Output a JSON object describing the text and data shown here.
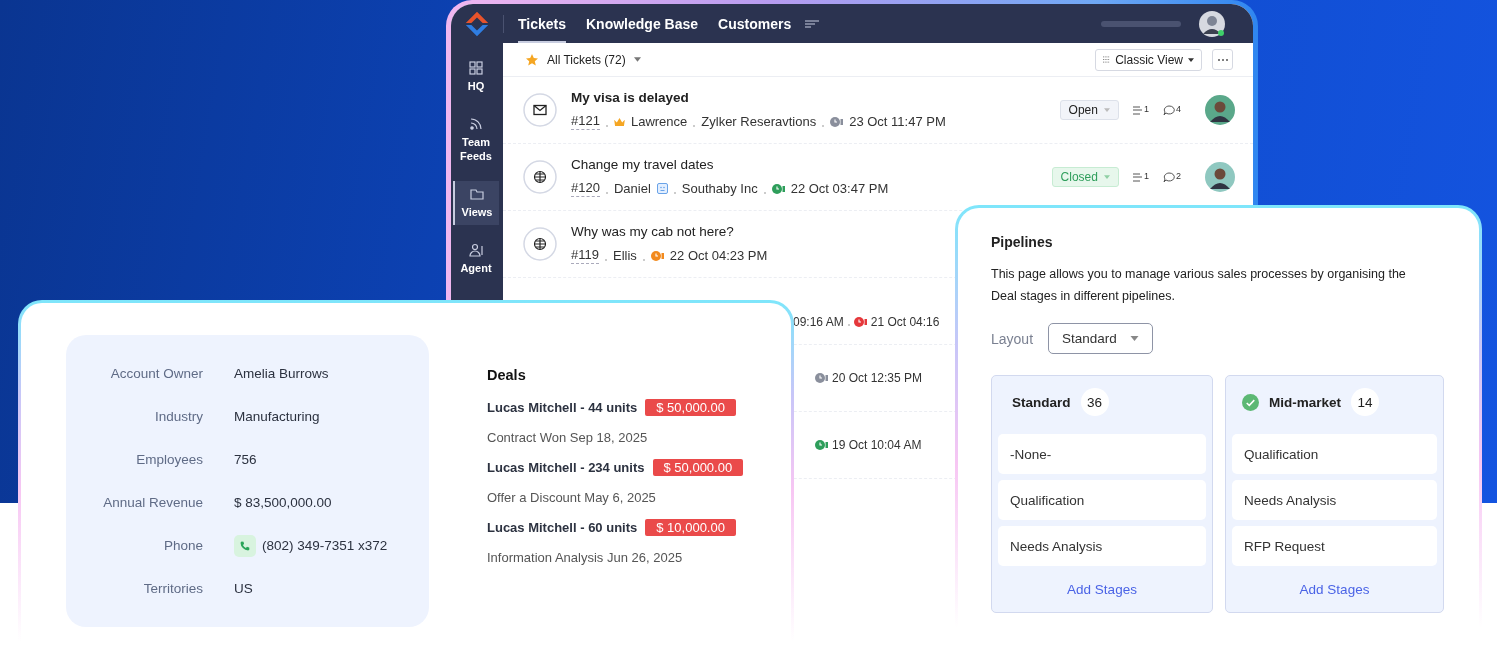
{
  "helpdesk": {
    "nav": [
      {
        "label": "Tickets",
        "selected": true
      },
      {
        "label": "Knowledge Base",
        "selected": false
      },
      {
        "label": "Customers",
        "selected": false
      }
    ],
    "sidebar": [
      {
        "label": "HQ",
        "selected": false
      },
      {
        "label": "Team Feeds",
        "selected": false
      },
      {
        "label": "Views",
        "selected": true
      },
      {
        "label": "Agent",
        "selected": false
      }
    ],
    "view_title": "All Tickets (72)",
    "view_mode": "Classic View",
    "tickets": [
      {
        "kind": "full",
        "title": "My visa is delayed",
        "bold": true,
        "number": "#121",
        "contact": "Lawrence",
        "account": "Zylker Reseravtions",
        "time": "23 Oct 11:47 PM",
        "color": "#8a8f9c",
        "status": {
          "label": "Open",
          "kind": "open"
        },
        "threads": "1",
        "comments": "4"
      },
      {
        "kind": "full",
        "title": "Change my travel dates",
        "bold": false,
        "number": "#120",
        "contact": "Daniel",
        "account": "Southaby Inc",
        "time": "22 Oct 03:47 PM",
        "color": "#2e9e5b",
        "status": {
          "label": "Closed",
          "kind": "closed"
        },
        "threads": "1",
        "comments": "2"
      },
      {
        "kind": "full",
        "title": "Why was my cab not here?",
        "bold": false,
        "number": "#119",
        "contact": "Ellis",
        "time": "22 Oct 04:23 PM",
        "color": "#f28a1e"
      },
      {
        "kind": "partial",
        "fragments": [
          {
            "text": "09:16 AM"
          },
          {
            "text": "21 Oct 04:16",
            "color": "#e5383b"
          }
        ]
      },
      {
        "kind": "partial",
        "fragments": [
          {
            "text": "20 Oct 12:35 PM",
            "color": "#8a8f9c"
          }
        ]
      },
      {
        "kind": "partial",
        "fragments": [
          {
            "text": "19 Oct 10:04 AM",
            "color": "#2e9e5b"
          }
        ]
      }
    ]
  },
  "account": {
    "fields": [
      {
        "label": "Account Owner",
        "value": "Amelia Burrows"
      },
      {
        "label": "Industry",
        "value": "Manufacturing"
      },
      {
        "label": "Employees",
        "value": "756"
      },
      {
        "label": "Annual Revenue",
        "value": "$ 83,500,000.00"
      },
      {
        "label": "Phone",
        "value": "(802) 349-7351 x372",
        "kind": "phone"
      },
      {
        "label": "Territories",
        "value": "US"
      }
    ],
    "deals_title": "Deals",
    "deals": [
      {
        "name": "Lucas Mitchell - 44 units",
        "amount": "$ 50,000.00",
        "stage": "Contract Won Sep 18, 2025"
      },
      {
        "name": "Lucas Mitchell - 234 units",
        "amount": "$ 50,000.00",
        "stage": "Offer a Discount May 6, 2025"
      },
      {
        "name": "Lucas Mitchell - 60 units",
        "amount": "$ 10,000.00",
        "stage": "Information Analysis Jun 26, 2025"
      }
    ]
  },
  "pipelines": {
    "title": "Pipelines",
    "description": "This page allows you to manage various sales processes by organising the Deal stages in different pipelines.",
    "layout_label": "Layout",
    "layout_value": "Standard",
    "columns": [
      {
        "name": "Standard",
        "count": "36",
        "default": false,
        "stages": [
          "-None-",
          "Qualification",
          "Needs Analysis"
        ],
        "action": "Add Stages"
      },
      {
        "name": "Mid-market",
        "count": "14",
        "default": true,
        "stages": [
          "Qualification",
          "Needs Analysis",
          "RFP Request"
        ],
        "action": "Add Stages"
      }
    ]
  }
}
